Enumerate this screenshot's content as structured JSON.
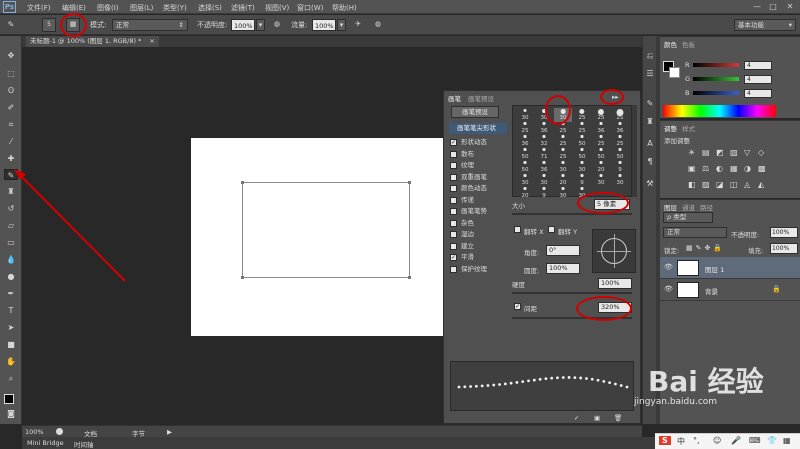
{
  "app": {
    "logo": "Ps",
    "menus": [
      "文件(F)",
      "编辑(E)",
      "图像(I)",
      "图层(L)",
      "类型(Y)",
      "选择(S)",
      "滤镜(T)",
      "视图(V)",
      "窗口(W)",
      "帮助(H)"
    ],
    "window_controls": [
      "—",
      "□",
      "✕"
    ]
  },
  "options_bar": {
    "brush_size": "5",
    "mode_label": "模式:",
    "mode_value": "正常",
    "opacity_label": "不透明度:",
    "opacity_value": "100%",
    "flow_label": "流量:",
    "flow_value": "100%",
    "workspace": "基本功能"
  },
  "document": {
    "tab_title": "未标题-1 @ 100% (图层 1, RGB/8) *",
    "tab_close": "×"
  },
  "status_bar": {
    "zoom": "100%",
    "doc_label": "文档",
    "bytes_label": "字节"
  },
  "bottom_tabs": [
    "Mini Bridge",
    "时间轴"
  ],
  "brush_panel": {
    "tabs": [
      "画笔",
      "画笔预设"
    ],
    "preset_button": "画笔预设",
    "tip_shape_label": "画笔笔尖形状",
    "options": [
      {
        "label": "形状动态",
        "checked": true
      },
      {
        "label": "散布",
        "checked": false
      },
      {
        "label": "纹理",
        "checked": false
      },
      {
        "label": "双重画笔",
        "checked": false
      },
      {
        "label": "颜色动态",
        "checked": false
      },
      {
        "label": "传递",
        "checked": false
      },
      {
        "label": "画笔笔势",
        "checked": false
      },
      {
        "label": "杂色",
        "checked": false
      },
      {
        "label": "湿边",
        "checked": false
      },
      {
        "label": "建立",
        "checked": false
      },
      {
        "label": "平滑",
        "checked": true
      },
      {
        "label": "保护纹理",
        "checked": false
      }
    ],
    "brush_sizes": [
      "30",
      "30",
      "30",
      "25",
      "25",
      "25",
      "25",
      "36",
      "25",
      "25",
      "36",
      "36",
      "36",
      "32",
      "25",
      "50",
      "25",
      "25",
      "50",
      "71",
      "25",
      "50",
      "50",
      "50",
      "50",
      "36",
      "30",
      "30",
      "20",
      "9",
      "30",
      "30",
      "20",
      "9",
      "30",
      "30",
      "20",
      "9",
      "30",
      "30"
    ],
    "size_label": "大小",
    "size_value": "5 像素",
    "flip_x": "翻转 X",
    "flip_y": "翻转 Y",
    "angle_label": "角度:",
    "angle_value": "0°",
    "roundness_label": "圆度:",
    "roundness_value": "100%",
    "hardness_label": "硬度",
    "hardness_value": "100%",
    "spacing_label": "间距",
    "spacing_value": "320%",
    "spacing_checked": true
  },
  "color_panel": {
    "tabs": [
      "颜色",
      "色板"
    ],
    "channels": [
      {
        "name": "R",
        "value": "4",
        "color": "#d23a3a"
      },
      {
        "name": "G",
        "value": "4",
        "color": "#3ac23a"
      },
      {
        "name": "B",
        "value": "4",
        "color": "#3a5fd2"
      }
    ]
  },
  "adjustments_panel": {
    "tabs": [
      "调整",
      "样式"
    ],
    "add_label": "添加调整"
  },
  "layers_panel": {
    "tabs": [
      "图层",
      "通道",
      "路径"
    ],
    "filter_label": "类型",
    "blend_mode": "正常",
    "opacity_label": "不透明度:",
    "opacity_value": "100%",
    "lock_label": "锁定:",
    "fill_label": "填充:",
    "fill_value": "100%",
    "layers": [
      {
        "name": "图层 1",
        "selected": true
      },
      {
        "name": "背景",
        "selected": false,
        "locked": true
      }
    ]
  },
  "watermark": {
    "brand": "Bai 经验",
    "url": "jingyan.baidu.com"
  },
  "ime_bar": {
    "logo": "S",
    "mode": "中"
  }
}
